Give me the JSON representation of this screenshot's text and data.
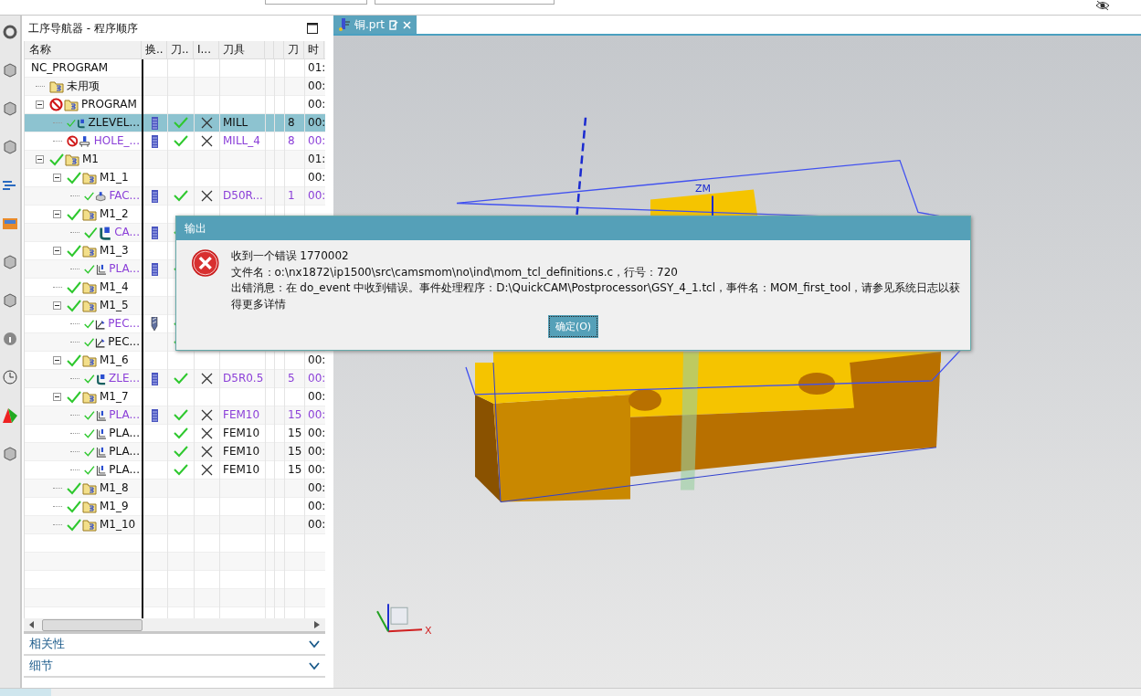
{
  "navigator": {
    "title": "工序导航器 - 程序顺序",
    "columns": [
      {
        "label": "名称"
      },
      {
        "label": "换.."
      },
      {
        "label": "刀.."
      },
      {
        "label": "I..."
      },
      {
        "label": "刀具"
      },
      {
        "label": "刀"
      },
      {
        "label": "时"
      }
    ],
    "rows": [
      {
        "name": "NC_PROGRAM",
        "selected": false,
        "time": "01:",
        "children": [
          {
            "name": "未用项",
            "kind": "folder",
            "selected": false,
            "time": "00:"
          },
          {
            "name": "PROGRAM",
            "kind": "folder",
            "selected": false,
            "complete": false,
            "expanded": true,
            "time": "00:",
            "children": [
              {
                "name": "ZLEVEL...",
                "kind": "zlevel",
                "complete": true,
                "selected": true,
                "modified": false,
                "tool_change": true,
                "path_ok": true,
                "verified": false,
                "tool": "MILL",
                "tool_no": "8",
                "time": "00:"
              },
              {
                "name": "HOLE_...",
                "kind": "drill",
                "complete": false,
                "selected": false,
                "modified": true,
                "tool_change": true,
                "path_ok": true,
                "verified": false,
                "tool": "MILL_4",
                "tool_no": "8",
                "time": "00:"
              }
            ]
          },
          {
            "name": "M1",
            "kind": "folder",
            "selected": false,
            "complete": true,
            "expanded": true,
            "time": "01:",
            "children": [
              {
                "name": "M1_1",
                "kind": "folder",
                "selected": false,
                "complete": true,
                "expanded": true,
                "time": "00:",
                "children": [
                  {
                    "name": "FAC...",
                    "kind": "face",
                    "complete": true,
                    "selected": false,
                    "modified": true,
                    "tool_change": true,
                    "path_ok": true,
                    "verified": false,
                    "tool": "D50R...",
                    "tool_no": "1",
                    "time": "00:"
                  }
                ]
              },
              {
                "name": "M1_2",
                "kind": "folder",
                "selected": false,
                "complete": true,
                "expanded": true,
                "children": [
                  {
                    "name": "CA...",
                    "kind": "zlevel",
                    "complete": true,
                    "selected": false,
                    "modified": true,
                    "tool_change": true,
                    "path_ok": true
                  }
                ]
              },
              {
                "name": "M1_3",
                "kind": "folder",
                "selected": false,
                "complete": true,
                "expanded": true,
                "children": [
                  {
                    "name": "PLA...",
                    "kind": "planar",
                    "complete": true,
                    "selected": false,
                    "modified": true,
                    "tool_change": true,
                    "path_ok": true
                  }
                ]
              },
              {
                "name": "M1_4",
                "kind": "folder",
                "selected": false,
                "complete": true
              },
              {
                "name": "M1_5",
                "kind": "folder",
                "selected": false,
                "complete": true,
                "expanded": true,
                "children": [
                  {
                    "name": "PEC...",
                    "kind": "pecking",
                    "complete": true,
                    "selected": false,
                    "modified": true,
                    "tool_change": true,
                    "path_ok": true
                  },
                  {
                    "name": "PEC...",
                    "kind": "pecking",
                    "complete": true,
                    "selected": false,
                    "modified": false,
                    "tool_change": false,
                    "path_ok": true
                  }
                ]
              },
              {
                "name": "M1_6",
                "kind": "folder",
                "selected": false,
                "complete": true,
                "expanded": true,
                "time": "00:",
                "children": [
                  {
                    "name": "ZLE...",
                    "kind": "zlevel",
                    "complete": true,
                    "selected": false,
                    "modified": true,
                    "tool_change": true,
                    "path_ok": true,
                    "verified": false,
                    "tool": "D5R0.5",
                    "tool_no": "5",
                    "time": "00:"
                  }
                ]
              },
              {
                "name": "M1_7",
                "kind": "folder",
                "selected": false,
                "complete": true,
                "expanded": true,
                "time": "00:",
                "children": [
                  {
                    "name": "PLA...",
                    "kind": "planar",
                    "complete": true,
                    "selected": false,
                    "modified": true,
                    "tool_change": true,
                    "path_ok": true,
                    "verified": false,
                    "tool": "FEM10",
                    "tool_no": "15",
                    "time": "00:"
                  },
                  {
                    "name": "PLA...",
                    "kind": "planar",
                    "complete": true,
                    "selected": false,
                    "modified": false,
                    "tool_change": false,
                    "path_ok": true,
                    "verified": false,
                    "tool": "FEM10",
                    "tool_no": "15",
                    "time": "00:"
                  },
                  {
                    "name": "PLA...",
                    "kind": "planar",
                    "complete": true,
                    "selected": false,
                    "modified": false,
                    "tool_change": false,
                    "path_ok": true,
                    "verified": false,
                    "tool": "FEM10",
                    "tool_no": "15",
                    "time": "00:"
                  },
                  {
                    "name": "PLA...",
                    "kind": "planar",
                    "complete": true,
                    "selected": false,
                    "modified": false,
                    "tool_change": false,
                    "path_ok": true,
                    "verified": false,
                    "tool": "FEM10",
                    "tool_no": "15",
                    "time": "00:"
                  }
                ]
              },
              {
                "name": "M1_8",
                "kind": "folder",
                "selected": false,
                "complete": true,
                "time": "00:"
              },
              {
                "name": "M1_9",
                "kind": "folder",
                "selected": false,
                "complete": true,
                "time": "00:"
              },
              {
                "name": "M1_10",
                "kind": "folder",
                "selected": false,
                "complete": true,
                "time": "00:"
              }
            ]
          }
        ]
      }
    ],
    "sections": [
      {
        "label": "相关性",
        "expanded": false
      },
      {
        "label": "细节",
        "expanded": false
      }
    ]
  },
  "document_tab": {
    "label": "铜.prt",
    "selected": true
  },
  "viewport": {
    "labels": [
      {
        "kind": "csys",
        "text": "ZM"
      },
      {
        "kind": "triad",
        "text": "X"
      }
    ]
  },
  "dialog": {
    "title": "输出",
    "lines": [
      "收到一个错误 1770002",
      "文件名：o:\\nx1872\\ip1500\\src\\camsmom\\no\\ind\\mom_tcl_definitions.c，行号：720",
      "出错消息：在 do_event 中收到错误。事件处理程序：D:\\QuickCAM\\Postprocessor\\GSY_4_1.tcl，事件名：MOM_first_tool，请参见系统日志以获得更多详情"
    ],
    "button": "确定(O)"
  }
}
